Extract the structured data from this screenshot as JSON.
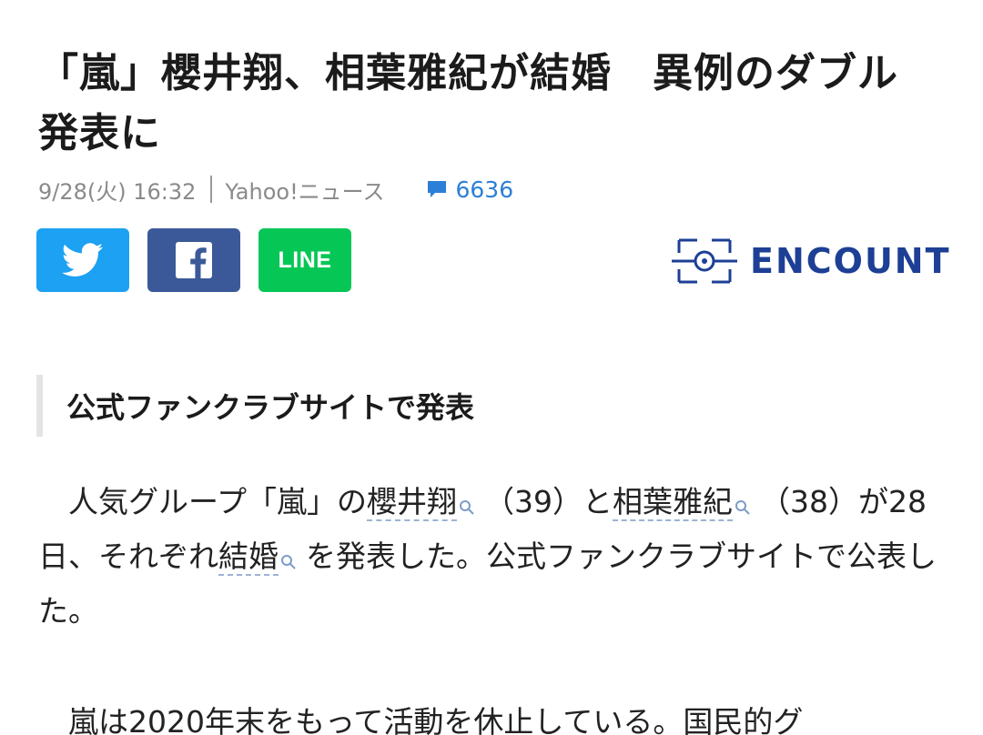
{
  "article": {
    "title_line1": "「嵐」櫻井翔、相葉雅紀が結婚　異例のダブル",
    "title_line2": "発表に",
    "date": "9/28(火) 16:32",
    "source": "Yahoo!ニュース",
    "comment_count": "6636",
    "comment_icon": "speech-bubble-icon",
    "accent_color": "#2b7fd6"
  },
  "share": {
    "twitter_icon": "twitter-bird-icon",
    "facebook_icon": "facebook-f-icon",
    "line_label": "LINE",
    "colors": {
      "twitter": "#1da1f2",
      "facebook": "#3b5998",
      "line": "#06c755"
    }
  },
  "brand": {
    "name": "ENCOUNT",
    "logo_icon": "crosshair-logo-icon",
    "color": "#1d3f95"
  },
  "section": {
    "heading": "公式ファンクラブサイトで発表"
  },
  "body": {
    "p1_a": "人気グループ「嵐」の",
    "p1_kw1": "櫻井翔",
    "p1_b": "（39）と",
    "p1_kw2": "相葉雅紀",
    "p1_c": "（38）が28日、それぞれ",
    "p1_kw3": "結婚",
    "p1_d": "を発表した。公式ファンクラブサイトで公表した。",
    "p2": "嵐は2020年末をもって活動を休止している。国民的グ",
    "keyword_icon": "search-icon"
  }
}
